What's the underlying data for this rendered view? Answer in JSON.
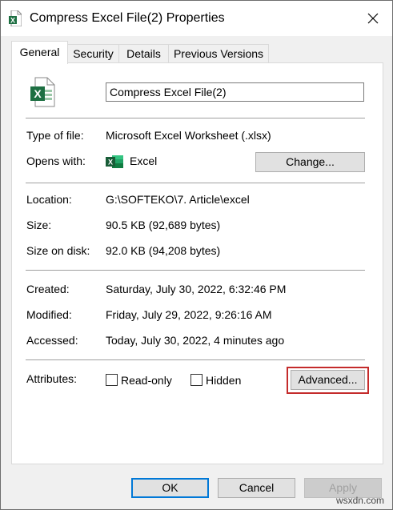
{
  "window": {
    "title": "Compress Excel File(2) Properties",
    "icon": "excel-file-icon",
    "close_icon": "close-icon"
  },
  "tabs": [
    {
      "label": "General",
      "active": true
    },
    {
      "label": "Security",
      "active": false
    },
    {
      "label": "Details",
      "active": false
    },
    {
      "label": "Previous Versions",
      "active": false
    }
  ],
  "general": {
    "file_name": "Compress Excel File(2)",
    "type_label": "Type of file:",
    "type_value": "Microsoft Excel Worksheet (.xlsx)",
    "opens_label": "Opens with:",
    "opens_value": "Excel",
    "change_button": "Change...",
    "location_label": "Location:",
    "location_value": "G:\\SOFTEKO\\7. Article\\excel",
    "size_label": "Size:",
    "size_value": "90.5 KB (92,689 bytes)",
    "size_disk_label": "Size on disk:",
    "size_disk_value": "92.0 KB (94,208 bytes)",
    "created_label": "Created:",
    "created_value": "Saturday, July 30, 2022, 6:32:46 PM",
    "modified_label": "Modified:",
    "modified_value": "Friday, July 29, 2022, 9:26:16 AM",
    "accessed_label": "Accessed:",
    "accessed_value": "Today, July 30, 2022, 4 minutes ago",
    "attributes_label": "Attributes:",
    "readonly_label": "Read-only",
    "readonly_checked": false,
    "hidden_label": "Hidden",
    "hidden_checked": false,
    "advanced_button": "Advanced..."
  },
  "footer": {
    "ok": "OK",
    "cancel": "Cancel",
    "apply": "Apply"
  },
  "watermark": "wsxdn.com",
  "colors": {
    "highlight": "#c42b2b",
    "excel_green": "#1d6f42",
    "focus_blue": "#0078d7"
  }
}
